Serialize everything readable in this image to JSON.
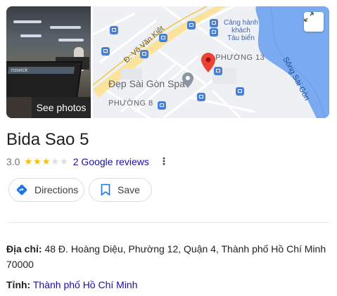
{
  "photo": {
    "button_label": "See photos",
    "sign_text": "nswick"
  },
  "map": {
    "road_label": "Đ. Võ Văn Kiệt",
    "port_label": [
      "Cảng hành",
      "khách",
      "Tàu biển"
    ],
    "ward13_label": "PHƯỜNG 13",
    "spa_label": "Đẹp Sài Gòn Spa",
    "ward8_label": "PHƯỜNG 8",
    "river_label": "Sông Sài Gòn",
    "expand_icon": "expand-icon"
  },
  "place": {
    "name": "Bida Sao 5",
    "rating": "3.0",
    "stars_filled": 3,
    "stars_total": 5,
    "reviews_label": "2 Google reviews"
  },
  "actions": {
    "directions_label": "Directions",
    "save_label": "Save"
  },
  "details": {
    "address_label": "Địa chỉ",
    "address_value": "48 Đ. Hoàng Diệu, Phường 12, Quận 4, Thành phố Hồ Chí Minh 70000",
    "province_label": "Tỉnh",
    "province_value": "Thành phố Hồ Chí Minh"
  },
  "colors": {
    "link": "#1a0dab",
    "star": "#fbbc04",
    "pin": "#ea4335",
    "river": "#3b7bea"
  }
}
